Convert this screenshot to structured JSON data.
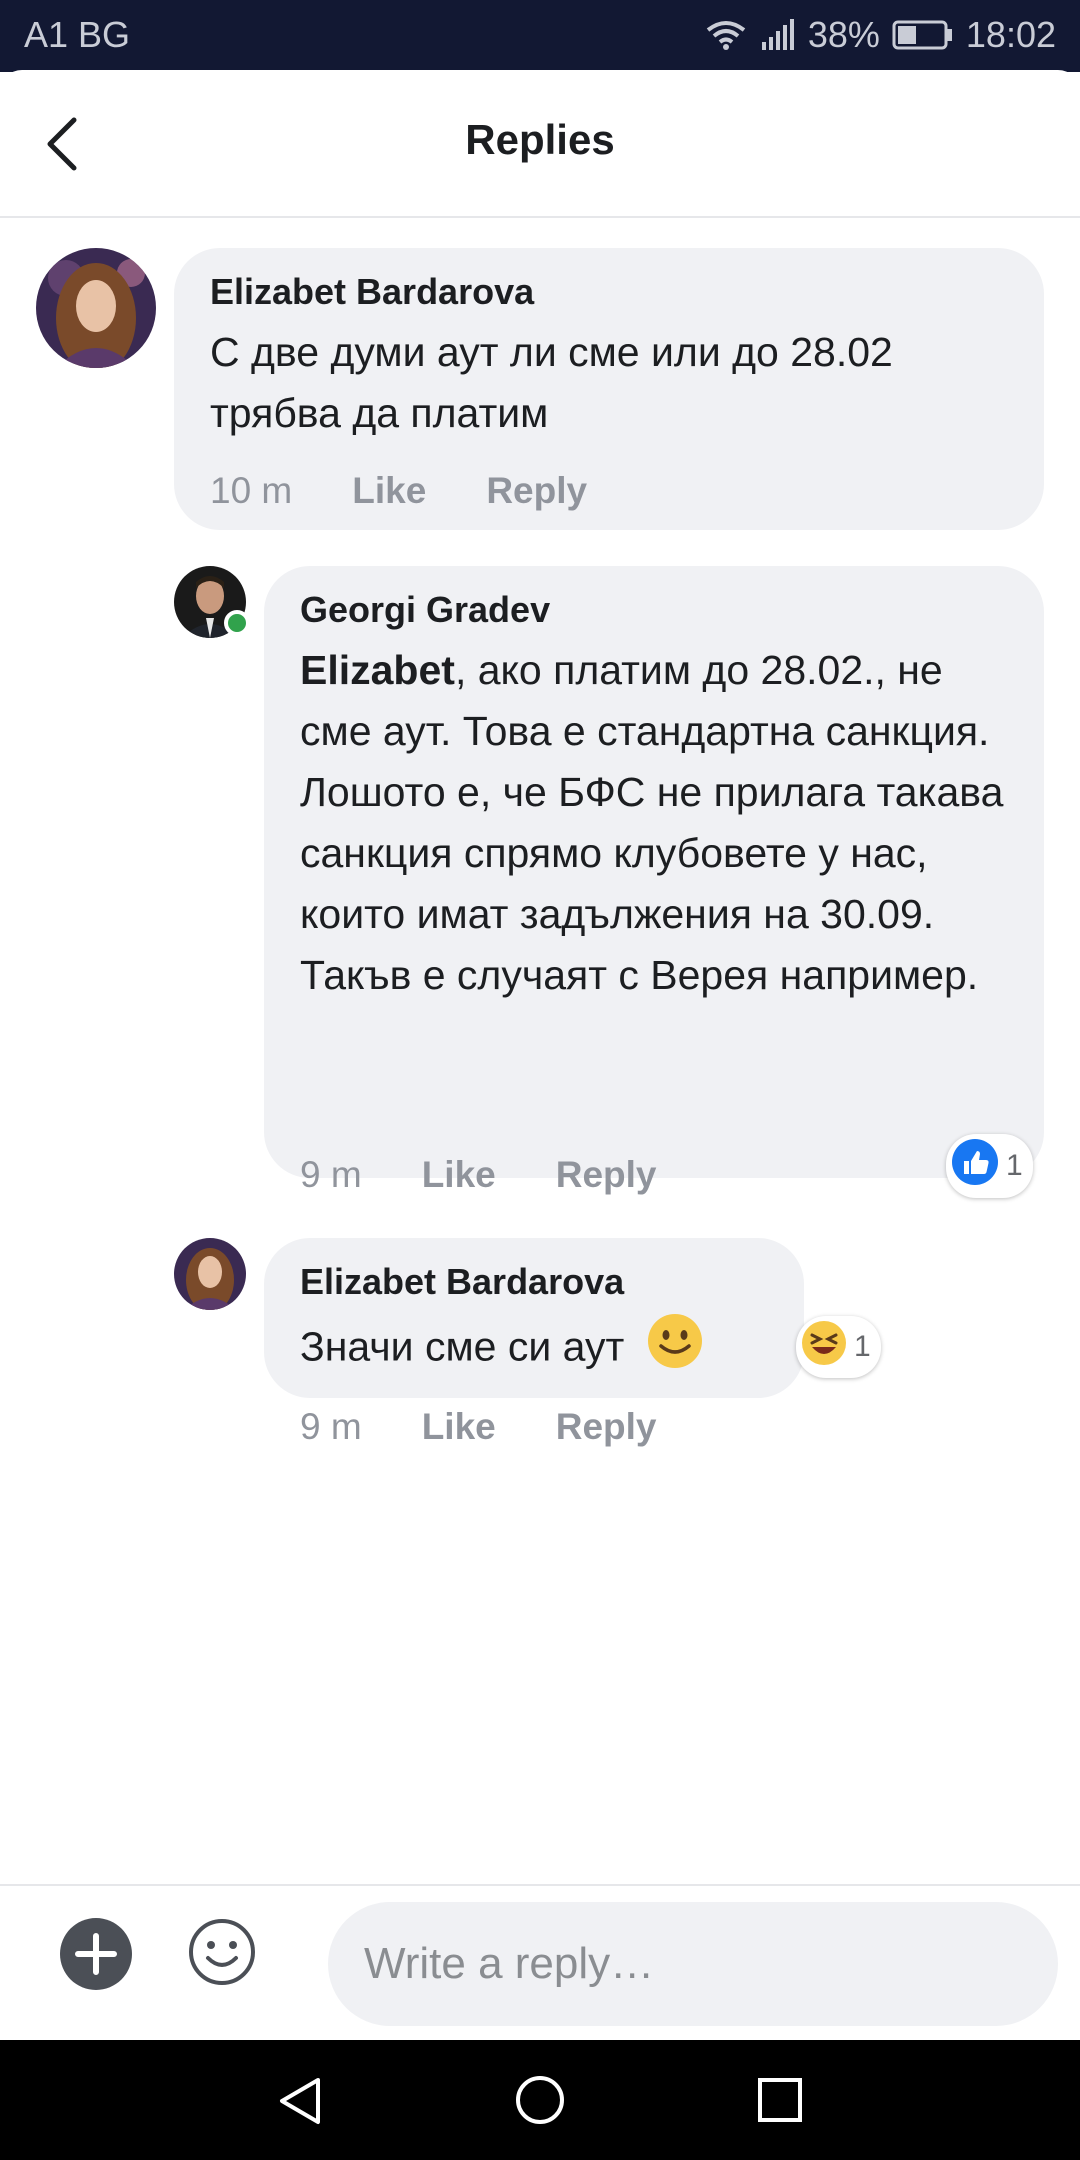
{
  "status_bar": {
    "carrier": "A1 BG",
    "battery": "38%",
    "time": "18:02",
    "icons": [
      "wifi-icon",
      "signal-icon",
      "battery-icon"
    ]
  },
  "header": {
    "title": "Replies",
    "back_icon": "chevron-left-icon"
  },
  "comments": [
    {
      "author": "Elizabet Bardarova",
      "text": "С две думи аут ли сме или до 28.02 трябва да платим",
      "time": "10 m",
      "like_label": "Like",
      "reply_label": "Reply"
    },
    {
      "author": "Georgi Gradev",
      "mention": "Elizabet",
      "text": ", ако платим до 28.02., не сме аут. Това е стандартна санкция. Лошото е, че БФС не прилага такава санкция спрямо клубовете у нас, които имат задължения на 30.09. Такъв е случаят с Верея например.",
      "time": "9 m",
      "like_label": "Like",
      "reply_label": "Reply",
      "online": true,
      "reaction": {
        "icon": "thumbs-up-icon",
        "count": "1",
        "color": "#1877f2"
      }
    },
    {
      "author": "Elizabet Bardarova",
      "text": "Значи сме си аут",
      "time": "9 m",
      "like_label": "Like",
      "reply_label": "Reply",
      "emoji": "🙂",
      "reaction": {
        "icon": "laughing-face-icon",
        "count": "1"
      }
    }
  ],
  "composer": {
    "placeholder": "Write a reply…",
    "add_icon": "plus-icon",
    "emoji_icon": "smiley-icon"
  },
  "nav_bar": {
    "icons": [
      "back-triangle-icon",
      "home-circle-icon",
      "recents-square-icon"
    ]
  }
}
